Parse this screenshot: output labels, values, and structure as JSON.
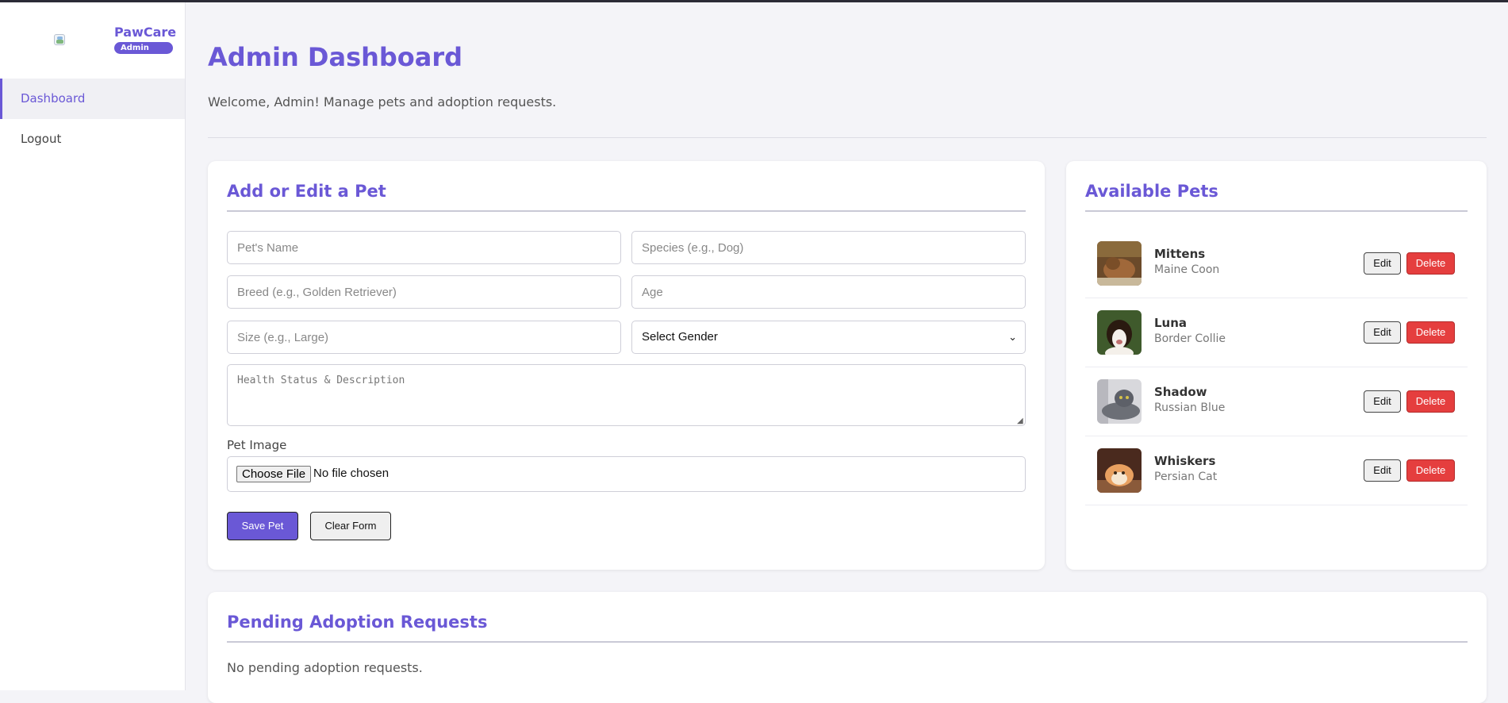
{
  "brand": {
    "name": "PawCare",
    "badge": "Admin"
  },
  "sidebar": {
    "items": [
      {
        "label": "Dashboard",
        "active": true
      },
      {
        "label": "Logout",
        "active": false
      }
    ]
  },
  "header": {
    "title": "Admin Dashboard",
    "subtitle": "Welcome, Admin! Manage pets and adoption requests."
  },
  "form": {
    "title": "Add or Edit a Pet",
    "name_placeholder": "Pet's Name",
    "species_placeholder": "Species (e.g., Dog)",
    "breed_placeholder": "Breed (e.g., Golden Retriever)",
    "age_placeholder": "Age",
    "size_placeholder": "Size (e.g., Large)",
    "gender_selected": "Select Gender",
    "description_placeholder": "Health Status & Description",
    "image_label": "Pet Image",
    "file_button": "Choose File",
    "file_status": "No file chosen",
    "save_label": "Save Pet",
    "clear_label": "Clear Form"
  },
  "pets": {
    "title": "Available Pets",
    "edit_label": "Edit",
    "delete_label": "Delete",
    "items": [
      {
        "name": "Mittens",
        "breed": "Maine Coon"
      },
      {
        "name": "Luna",
        "breed": "Border Collie"
      },
      {
        "name": "Shadow",
        "breed": "Russian Blue"
      },
      {
        "name": "Whiskers",
        "breed": "Persian Cat"
      }
    ]
  },
  "requests": {
    "title": "Pending Adoption Requests",
    "empty_text": "No pending adoption requests."
  },
  "colors": {
    "accent": "#6a58d6",
    "danger": "#e53e3e",
    "background": "#f4f4f8"
  }
}
